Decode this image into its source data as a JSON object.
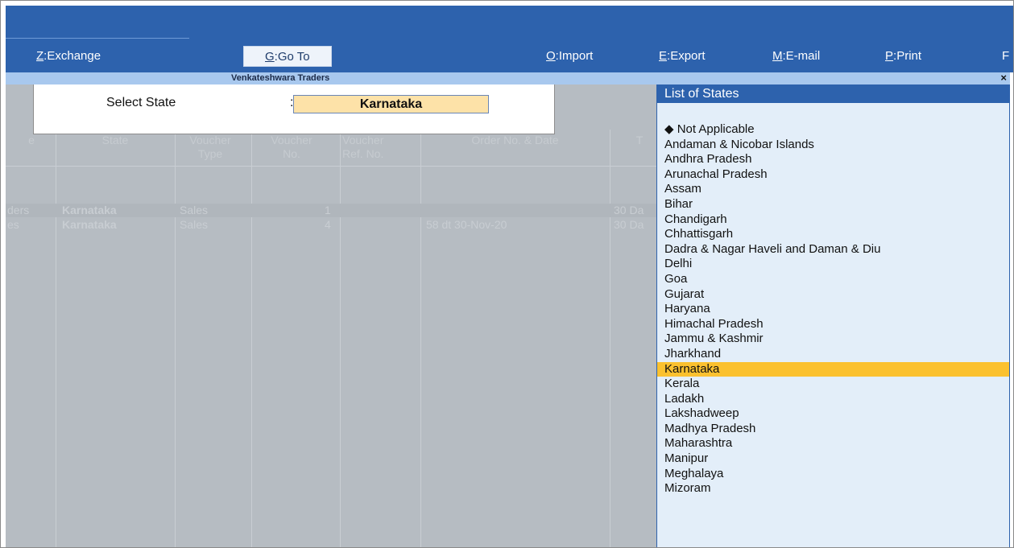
{
  "toolbar": {
    "exchange": {
      "key": "Z",
      "label": "Exchange"
    },
    "goto": {
      "key": "G",
      "label": "Go To"
    },
    "import": {
      "key": "O",
      "label": "Import"
    },
    "export": {
      "key": "E",
      "label": "Export"
    },
    "email": {
      "key": "M",
      "label": "E-mail"
    },
    "print": {
      "key": "P",
      "label": "Print"
    },
    "more": "F"
  },
  "title": "Venkateshwara Traders",
  "close_glyph": "×",
  "dialog": {
    "label": "Select State",
    "colon": ":",
    "value": "Karnataka"
  },
  "report": {
    "headers": {
      "party_partial": "e",
      "state": "State",
      "voucher_type": "Voucher\nType",
      "voucher_no": "Voucher\nNo.",
      "voucher_ref": "Voucher\nRef. No.",
      "order_no": "Order No. & Date",
      "terms_partial": "T"
    },
    "rows": [
      {
        "party": "ders",
        "state": "Karnataka",
        "type": "Sales",
        "no": "1",
        "order": "",
        "terms": "30 Da"
      },
      {
        "party": "es",
        "state": "Karnataka",
        "type": "Sales",
        "no": "4",
        "order": "58 dt 30-Nov-20",
        "terms": "30 Da"
      }
    ]
  },
  "states_list": {
    "title": "List of States",
    "selected": "Karnataka",
    "items": [
      "◆ Not Applicable",
      "Andaman & Nicobar Islands",
      "Andhra Pradesh",
      "Arunachal Pradesh",
      "Assam",
      "Bihar",
      "Chandigarh",
      "Chhattisgarh",
      "Dadra & Nagar Haveli and Daman & Diu",
      "Delhi",
      "Goa",
      "Gujarat",
      "Haryana",
      "Himachal Pradesh",
      "Jammu & Kashmir",
      "Jharkhand",
      "Karnataka",
      "Kerala",
      "Ladakh",
      "Lakshadweep",
      "Madhya Pradesh",
      "Maharashtra",
      "Manipur",
      "Meghalaya",
      "Mizoram"
    ]
  },
  "colors": {
    "toolbar_bg": "#2d62ad",
    "selection": "#fbc12f",
    "input_bg": "#fde2a8",
    "list_bg": "#e3eef9"
  }
}
